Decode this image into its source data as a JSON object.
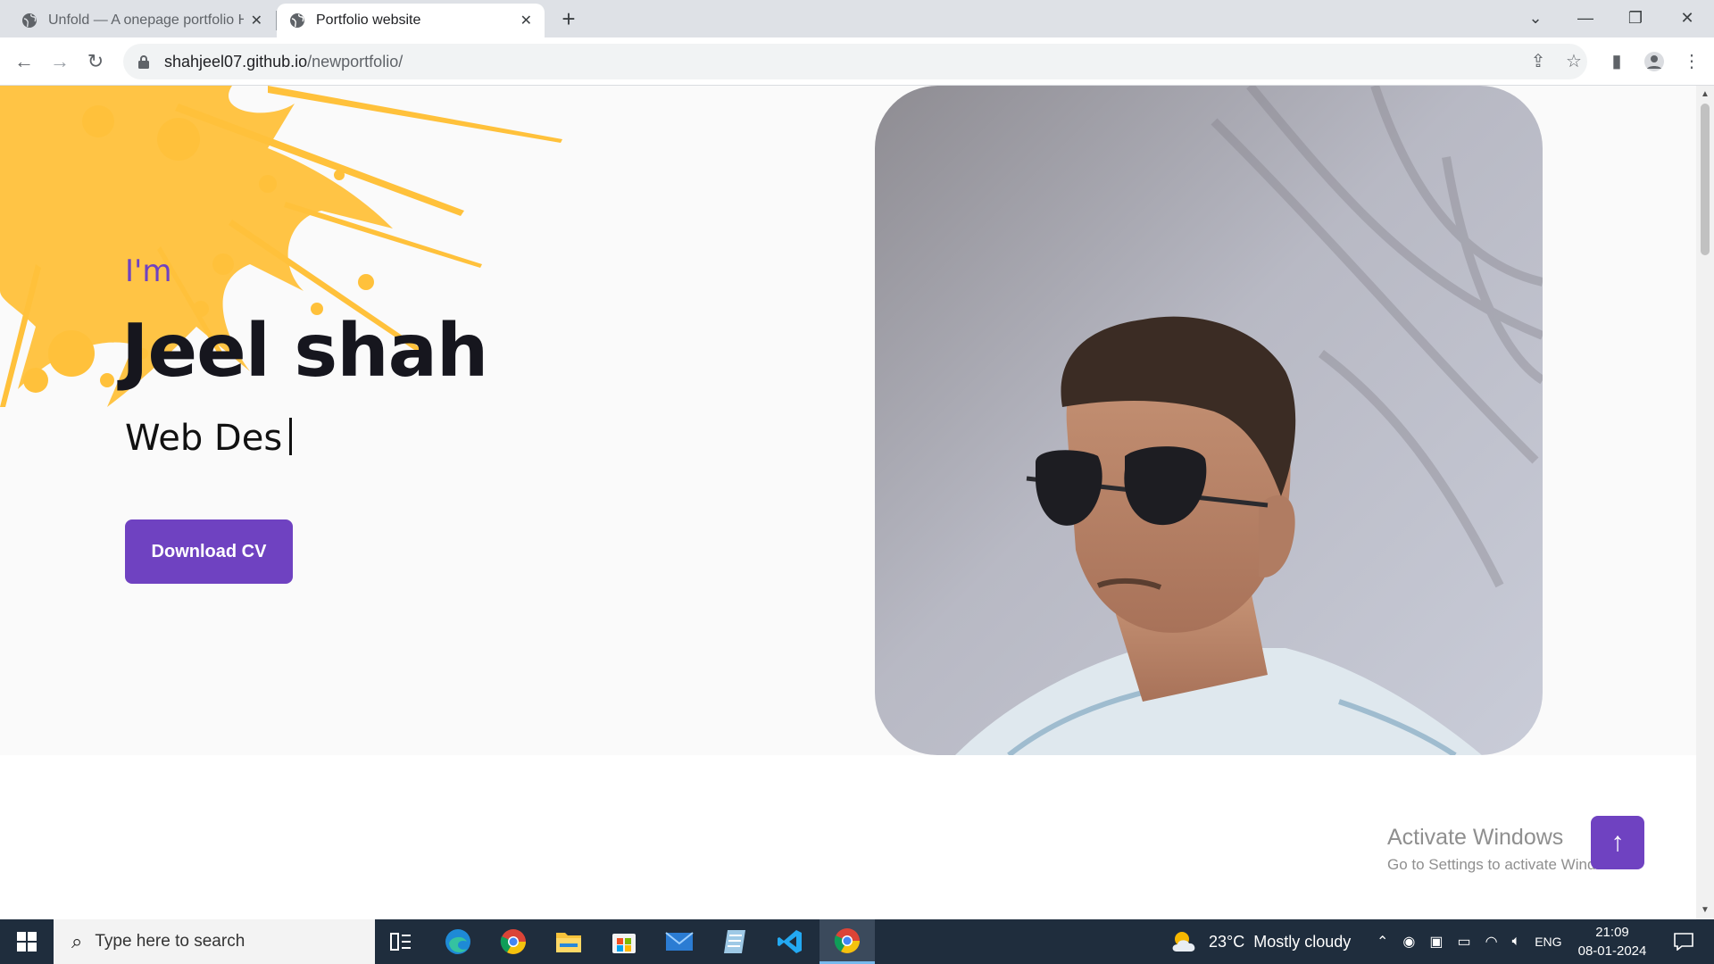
{
  "browser": {
    "tabs": [
      {
        "title": "Unfold — A onepage portfolio H",
        "active": false
      },
      {
        "title": "Portfolio website",
        "active": true
      }
    ],
    "url_host": "shahjeel07.github.io",
    "url_path": "/newportfolio/"
  },
  "hero": {
    "intro": "I'm",
    "name": "Jeel shah",
    "role_typed": "Web Des",
    "cv_button": "Download CV"
  },
  "watermark": {
    "title": "Activate Windows",
    "subtitle": "Go to Settings to activate Windows."
  },
  "taskbar": {
    "search_placeholder": "Type here to search",
    "weather_temp": "23°C",
    "weather_text": "Mostly cloudy",
    "language": "ENG",
    "time": "21:09",
    "date": "08-01-2024"
  },
  "colors": {
    "accent": "#6f42c1",
    "splash": "#ffc13b",
    "taskbar": "#1f2d3d"
  }
}
